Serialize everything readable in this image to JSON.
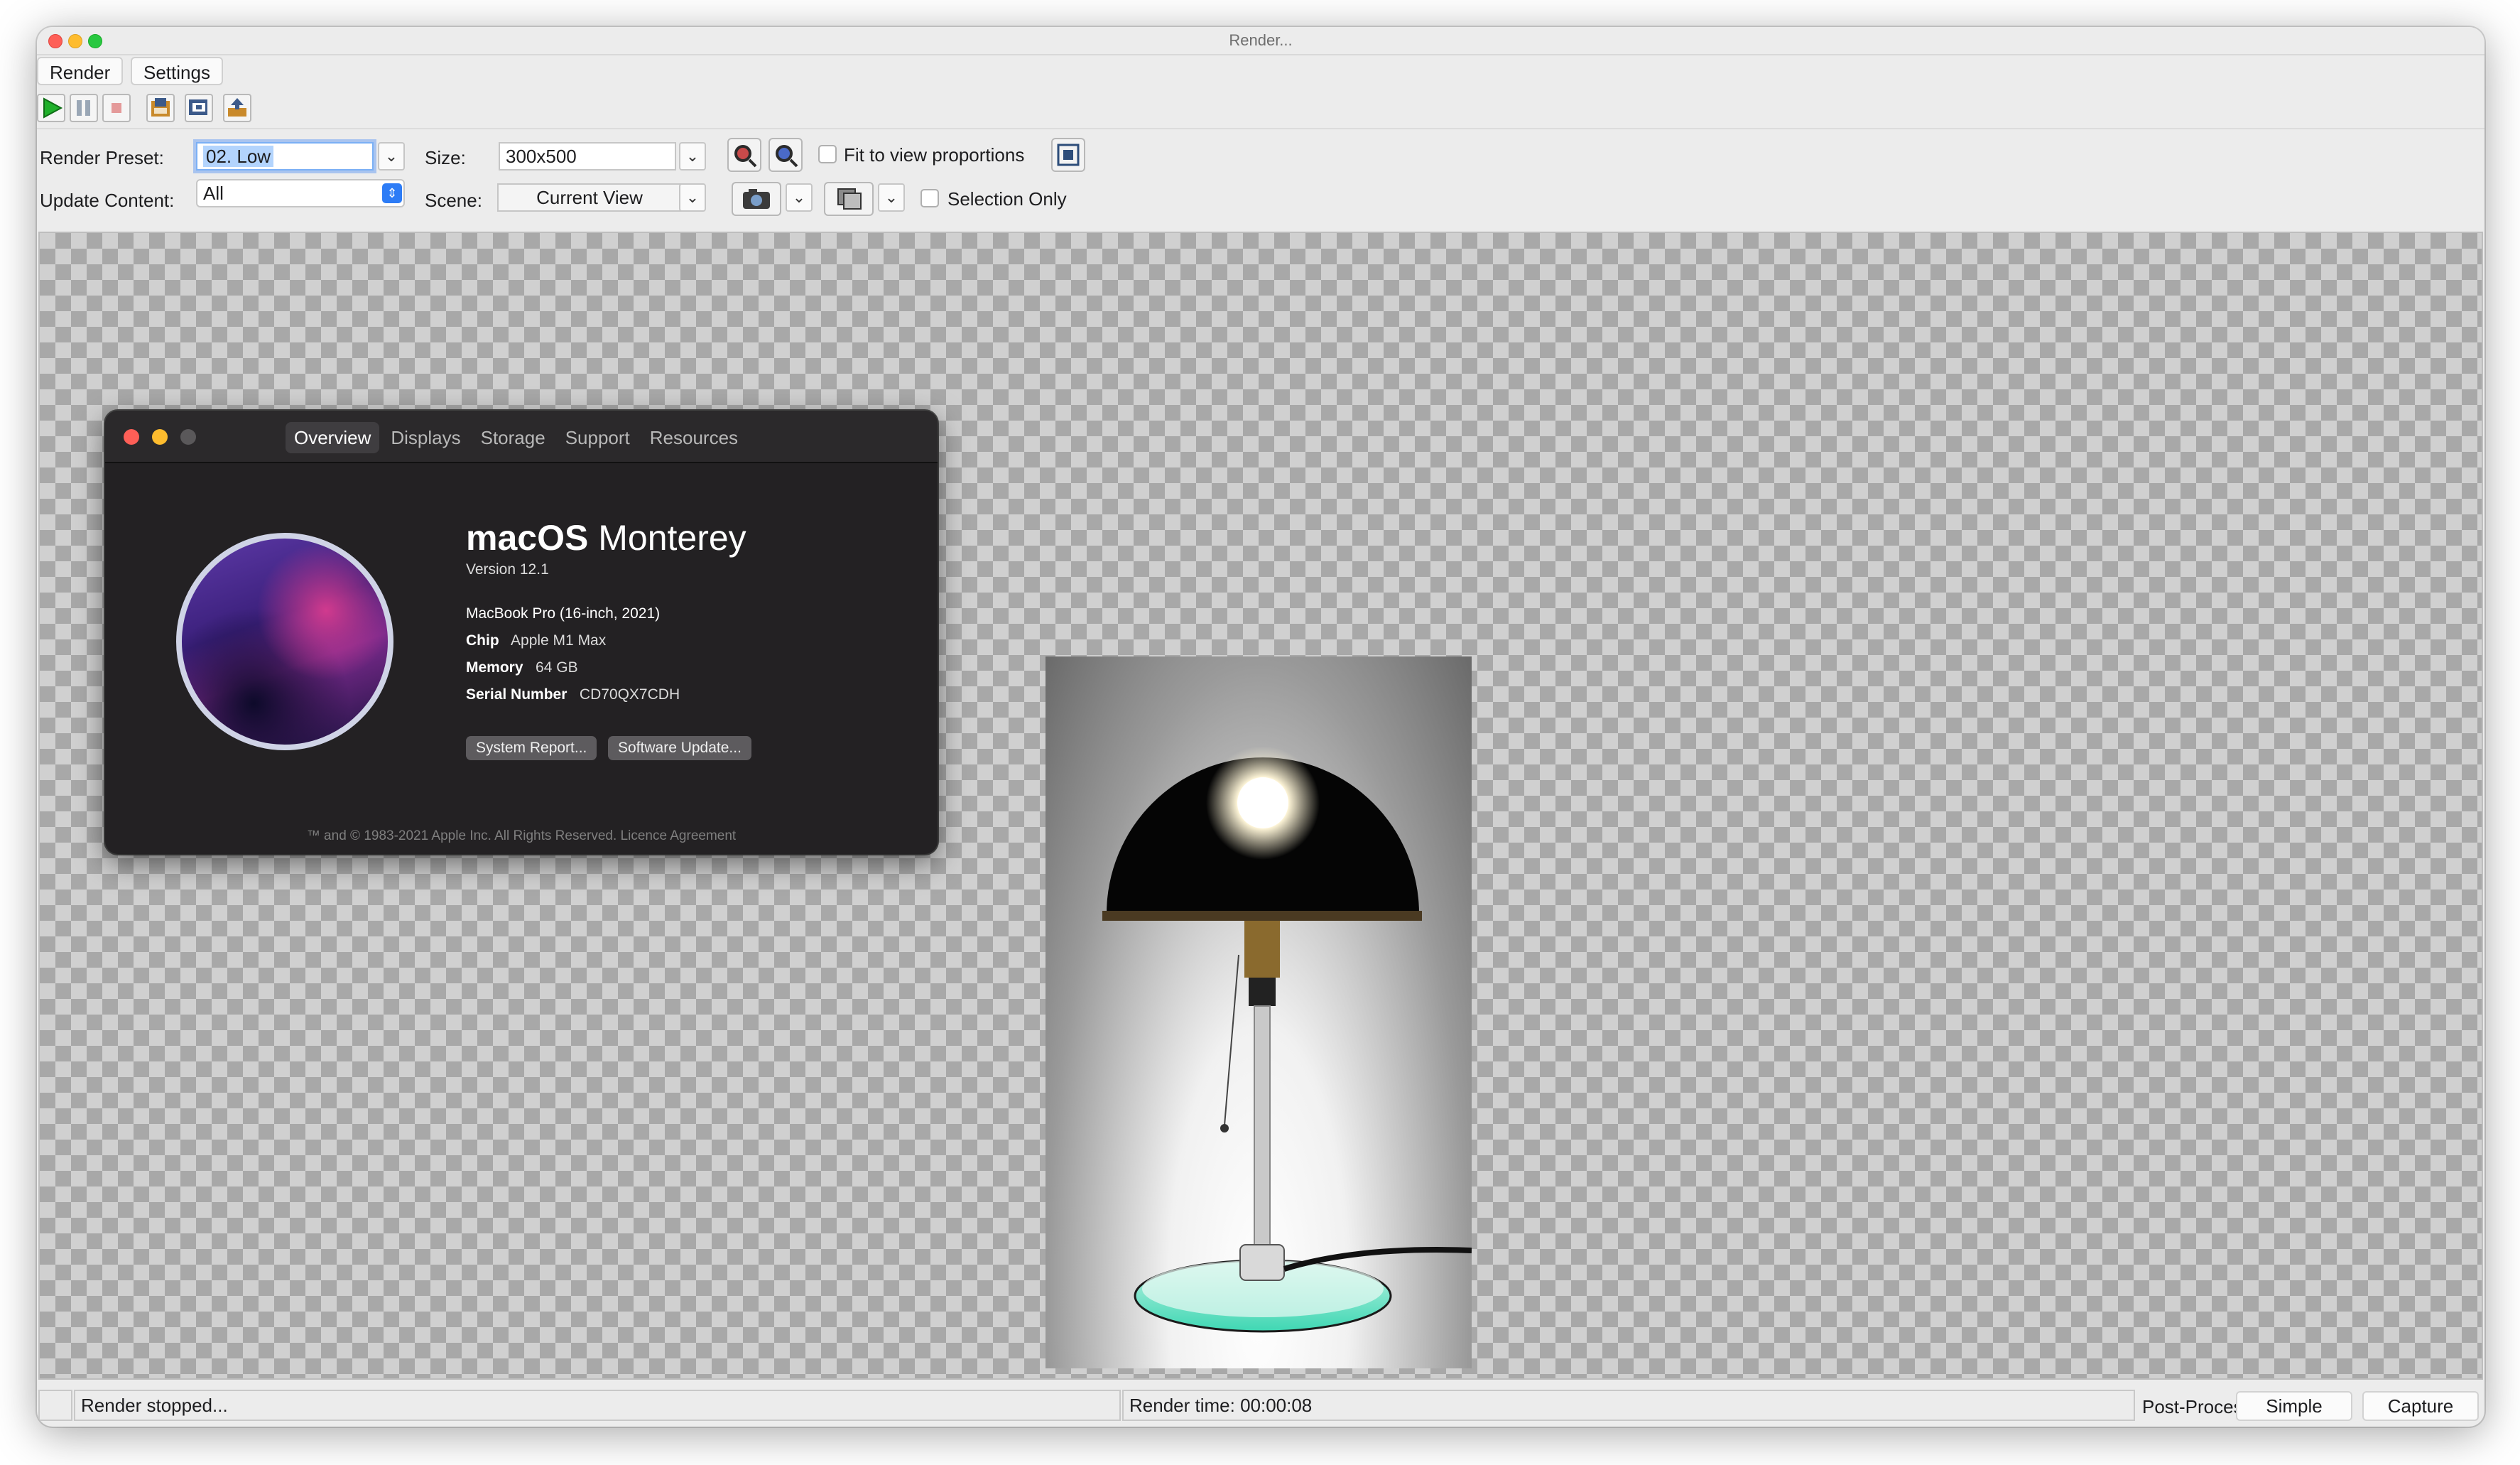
{
  "window": {
    "title": "Render..."
  },
  "menu": {
    "render_label": "Render",
    "settings_label": "Settings"
  },
  "form": {
    "render_preset_label": "Render Preset:",
    "render_preset_value": "02. Low",
    "update_content_label": "Update Content:",
    "update_content_value": "All",
    "size_label": "Size:",
    "size_value": "300x500",
    "scene_label": "Scene:",
    "scene_value": "Current View",
    "fit_label": "Fit to view proportions",
    "selection_label": "Selection Only"
  },
  "about": {
    "tabs": [
      "Overview",
      "Displays",
      "Storage",
      "Support",
      "Resources"
    ],
    "os_name_bold": "macOS",
    "os_name_rest": "Monterey",
    "version": "Version 12.1",
    "model": "MacBook Pro (16-inch, 2021)",
    "chip_label": "Chip",
    "chip_value": "Apple M1 Max",
    "memory_label": "Memory",
    "memory_value": "64 GB",
    "serial_label": "Serial Number",
    "serial_value": "CD70QX7CDH",
    "system_report_label": "System Report...",
    "software_update_label": "Software Update...",
    "footer": "™ and © 1983-2021 Apple Inc. All Rights Reserved. Licence Agreement"
  },
  "status": {
    "message": "Render stopped...",
    "render_time": "Render time: 00:00:08",
    "post_process_label": "Post-Process:",
    "simple_label": "Simple",
    "capture_label": "Capture"
  },
  "icons": [
    "play-icon",
    "pause-icon",
    "stop-icon",
    "save-image-icon",
    "copy-image-icon",
    "export-icon",
    "zoom-in-icon",
    "zoom-out-icon",
    "fit-view-icon",
    "camera-icon",
    "layers-icon",
    "chevron-down-icon"
  ],
  "colors": {
    "accent": "#2d7cf6",
    "canvas_light": "#d0d0d0",
    "canvas_dark": "#a8a8a8"
  }
}
